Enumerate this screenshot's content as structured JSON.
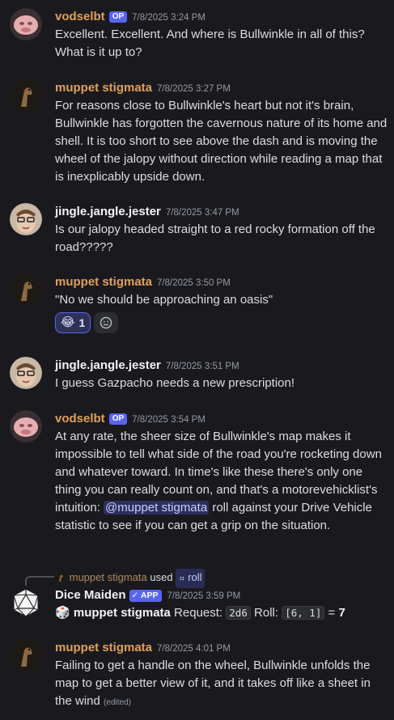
{
  "messages": [
    {
      "author": "vodselbt",
      "badge": "OP",
      "timestamp": "7/8/2025 3:24 PM",
      "text": "Excellent. Excellent. And where is Bullwinkle in all of this? What is it up to?"
    },
    {
      "author": "muppet stigmata",
      "timestamp": "7/8/2025 3:27 PM",
      "text": "For reasons close to Bullwinkle's heart but not it's brain, Bullwinkle has forgotten the cavernous nature of its home and shell. It is too short to see above the dash and is moving the wheel of the jalopy without direction while reading a map that is inexplicably upside down."
    },
    {
      "author": "jingle.jangle.jester",
      "timestamp": "7/8/2025 3:47 PM",
      "text": "Is our jalopy headed straight to a red rocky formation off the road?????"
    },
    {
      "author": "muppet stigmata",
      "timestamp": "7/8/2025 3:50 PM",
      "text": "\"No we should be approaching an oasis\"",
      "reaction": {
        "emoji": "😂",
        "count": "1",
        "add_icon": "add-reaction-icon"
      }
    },
    {
      "author": "jingle.jangle.jester",
      "timestamp": "7/8/2025 3:51 PM",
      "text": "I guess Gazpacho needs a new prescription!"
    },
    {
      "author": "vodselbt",
      "badge": "OP",
      "timestamp": "7/8/2025 3:54 PM",
      "text_before": "At any rate, the sheer size of Bullwinkle's map makes it impossible to tell what side of the road you're rocketing down and whatever toward. In time's like these there's only one thing you can really count on, and that's a motorevehicklist's intuition: ",
      "mention": "@muppet stigmata",
      "text_after": " roll against your Drive Vehicle statistic to see if you can get a grip on the situation."
    },
    {
      "used_by": "muppet stigmata",
      "used_word": "used",
      "command": "roll",
      "author": "Dice Maiden",
      "badge": "APP",
      "timestamp": "7/8/2025 3:59 PM",
      "roll": {
        "user": "muppet stigmata",
        "request_label": "Request:",
        "request": "2d6",
        "roll_label": "Roll:",
        "roll": "[6, 1]",
        "equals": "=",
        "result": "7"
      }
    },
    {
      "author": "muppet stigmata",
      "timestamp": "7/8/2025 4:01 PM",
      "text": "Failing to get a handle on the wheel, Bullwinkle unfolds the map to get a better view of it, and it takes off like a sheet in the wind",
      "edited": "(edited)"
    }
  ],
  "colors": {
    "background": "#1a1a1e",
    "username_orange": "#e0a05a",
    "accent": "#5865f2"
  }
}
